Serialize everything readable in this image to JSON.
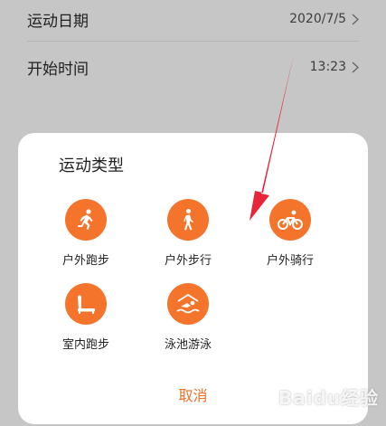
{
  "settings": {
    "date": {
      "label": "运动日期",
      "value": "2020/7/5"
    },
    "time": {
      "label": "开始时间",
      "value": "13:23"
    }
  },
  "sheet": {
    "title": "运动类型",
    "types": [
      {
        "label": "户外跑步",
        "icon": "running-icon"
      },
      {
        "label": "户外步行",
        "icon": "walking-icon"
      },
      {
        "label": "户外骑行",
        "icon": "cycling-icon"
      },
      {
        "label": "室内跑步",
        "icon": "treadmill-icon"
      },
      {
        "label": "泳池游泳",
        "icon": "swimming-icon"
      }
    ],
    "cancel_label": "取消"
  },
  "watermark": "Baidu经验",
  "colors": {
    "accent": "#f4742b",
    "cancel": "#f26e25",
    "arrow": "#e8263a",
    "overlay": "#c6c6c6"
  }
}
